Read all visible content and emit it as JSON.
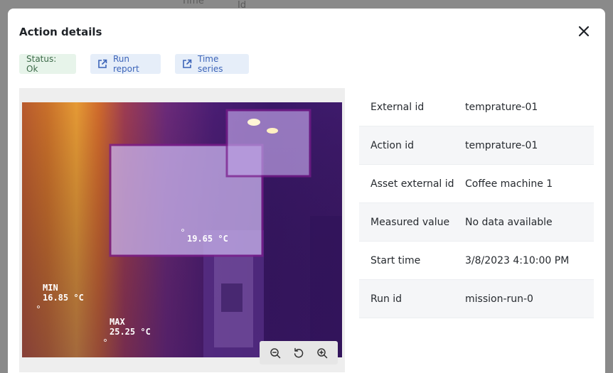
{
  "background": {
    "time_label": "Time",
    "id_label": "Id"
  },
  "modal": {
    "title": "Action details",
    "chips": {
      "status": "Status: Ok",
      "run_report": "Run report",
      "time_series": "Time series"
    }
  },
  "thermal_image": {
    "reading_label": "19.65 °C",
    "min_label": "MIN",
    "min_value": "16.85 °C",
    "max_label": "MAX",
    "max_value": "25.25 °C"
  },
  "details": [
    {
      "key": "External id",
      "value": "temprature-01"
    },
    {
      "key": "Action id",
      "value": "temprature-01"
    },
    {
      "key": "Asset external id",
      "value": "Coffee machine 1"
    },
    {
      "key": "Measured value",
      "value": "No data available"
    },
    {
      "key": "Start time",
      "value": "3/8/2023 4:10:00 PM"
    },
    {
      "key": "Run id",
      "value": "mission-run-0"
    }
  ],
  "colors": {
    "status_green": "#3d6b49",
    "link_blue": "#3c64b8",
    "thermal_purple": "#4a1a7a",
    "thermal_orange": "#d9862a"
  },
  "icons": [
    "external-link-icon",
    "close-icon",
    "zoom-out-icon",
    "reset-icon",
    "zoom-in-icon"
  ]
}
